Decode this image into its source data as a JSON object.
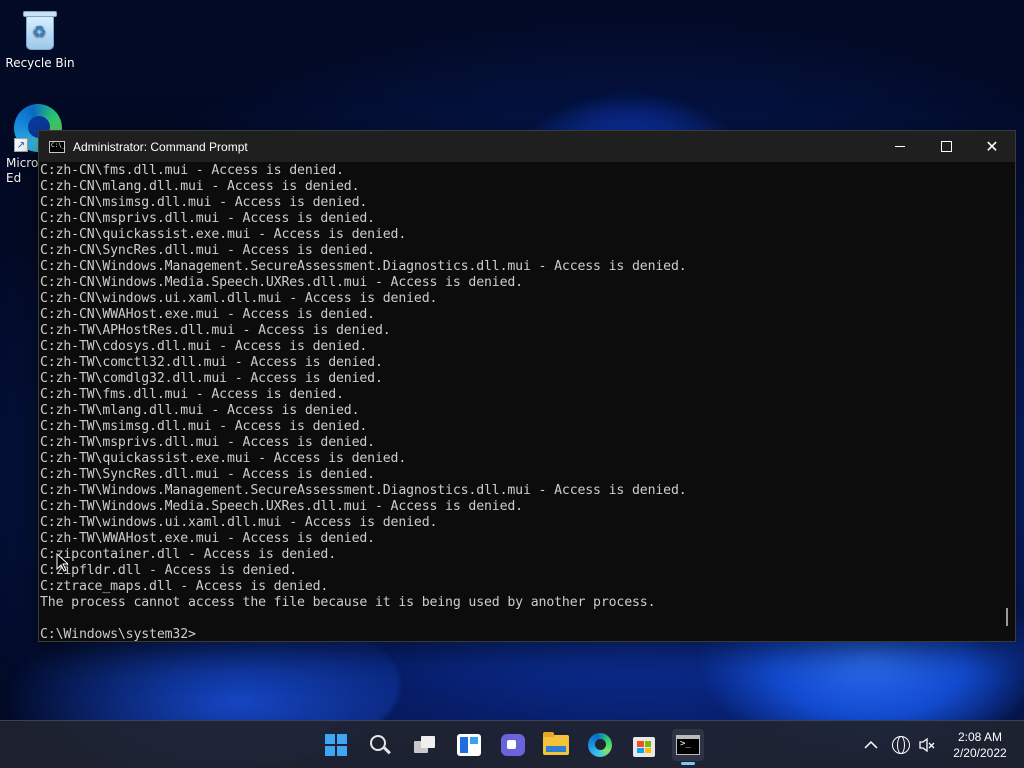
{
  "desktop": {
    "icons": [
      {
        "label": "Recycle Bin"
      },
      {
        "label": "Micro\nEd"
      }
    ]
  },
  "window": {
    "title": "Administrator: Command Prompt",
    "lines": [
      "C:zh-CN\\fms.dll.mui - Access is denied.",
      "C:zh-CN\\mlang.dll.mui - Access is denied.",
      "C:zh-CN\\msimsg.dll.mui - Access is denied.",
      "C:zh-CN\\msprivs.dll.mui - Access is denied.",
      "C:zh-CN\\quickassist.exe.mui - Access is denied.",
      "C:zh-CN\\SyncRes.dll.mui - Access is denied.",
      "C:zh-CN\\Windows.Management.SecureAssessment.Diagnostics.dll.mui - Access is denied.",
      "C:zh-CN\\Windows.Media.Speech.UXRes.dll.mui - Access is denied.",
      "C:zh-CN\\windows.ui.xaml.dll.mui - Access is denied.",
      "C:zh-CN\\WWAHost.exe.mui - Access is denied.",
      "C:zh-TW\\APHostRes.dll.mui - Access is denied.",
      "C:zh-TW\\cdosys.dll.mui - Access is denied.",
      "C:zh-TW\\comctl32.dll.mui - Access is denied.",
      "C:zh-TW\\comdlg32.dll.mui - Access is denied.",
      "C:zh-TW\\fms.dll.mui - Access is denied.",
      "C:zh-TW\\mlang.dll.mui - Access is denied.",
      "C:zh-TW\\msimsg.dll.mui - Access is denied.",
      "C:zh-TW\\msprivs.dll.mui - Access is denied.",
      "C:zh-TW\\quickassist.exe.mui - Access is denied.",
      "C:zh-TW\\SyncRes.dll.mui - Access is denied.",
      "C:zh-TW\\Windows.Management.SecureAssessment.Diagnostics.dll.mui - Access is denied.",
      "C:zh-TW\\Windows.Media.Speech.UXRes.dll.mui - Access is denied.",
      "C:zh-TW\\windows.ui.xaml.dll.mui - Access is denied.",
      "C:zh-TW\\WWAHost.exe.mui - Access is denied.",
      "C:zipcontainer.dll - Access is denied.",
      "C:zipfldr.dll - Access is denied.",
      "C:ztrace_maps.dll - Access is denied.",
      "The process cannot access the file because it is being used by another process.",
      "",
      "C:\\Windows\\system32>"
    ]
  },
  "taskbar": {
    "icons": [
      "start-icon",
      "search-icon",
      "task-view-icon",
      "widgets-icon",
      "teams-chat-icon",
      "file-explorer-icon",
      "edge-icon",
      "store-icon",
      "command-prompt-icon"
    ],
    "clock": {
      "time": "2:08 AM",
      "date": "2/20/2022"
    }
  }
}
